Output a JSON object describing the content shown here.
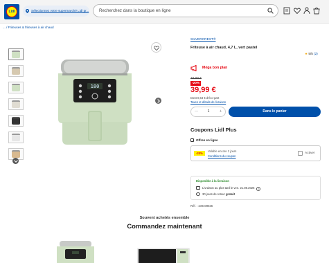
{
  "header": {
    "logo_text": "Lidl",
    "store_link": "Sélectionnez votre supermarché Lidl pr...",
    "search_placeholder": "Recherchez dans la boutique en ligne"
  },
  "breadcrumb": "... / Friteuses & friteuses à air chaud",
  "product": {
    "brand": "SILVERCREST®",
    "title": "Friteuse à air chaud, 4,7 L, vert pastel",
    "rating_text": "5/5",
    "rating_count": "(2)",
    "promo_label": "Méga bon plan",
    "old_price": "49,99 €",
    "discount": "-20%",
    "price": "39,99 €",
    "eco_fee": "Dont 0,64 € d'éco-part",
    "tax_link": "Taxes et détails de livraison",
    "quantity": "1",
    "cart_button": "Dans le panier",
    "colors": {
      "accent": "#0050aa",
      "price": "#e60a14",
      "badge": "#fff200",
      "product": "#cfe0c3"
    }
  },
  "coupons": {
    "title": "Coupons Lidl Plus",
    "offers_label": "Offres en ligne",
    "badge": "-20%",
    "validity": "Valable encore 2 jours",
    "conditions": "Conditions du coupon",
    "activate": "Activer"
  },
  "availability": {
    "title": "Disponible à la livraison",
    "delivery": "Livraison au plus tard le ven. 21.08.2026",
    "return_prefix": "30 jours de retour",
    "return_free": "gratuit"
  },
  "reference": "Réf. : 100409836",
  "recommendations": {
    "subtitle": "Souvent achetés ensemble",
    "title": "Commandez maintenant"
  }
}
